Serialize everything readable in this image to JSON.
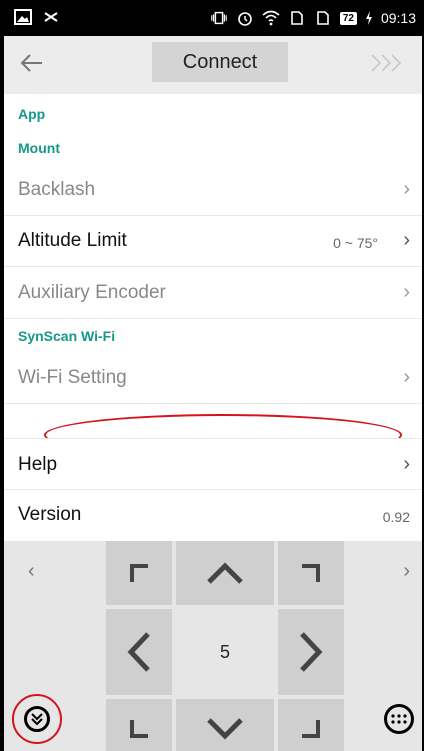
{
  "status_bar": {
    "time": "09:13",
    "battery": "72"
  },
  "toolbar": {
    "connect_label": "Connect"
  },
  "sections": {
    "app": "App",
    "mount": "Mount",
    "wifi": "SynScan Wi-Fi"
  },
  "rows": {
    "backlash": "Backlash",
    "altitude_limit": "Altitude Limit",
    "altitude_value": "0 ~ 75°",
    "auxiliary_encoder": "Auxiliary Encoder",
    "wifi_setting": "Wi-Fi Setting",
    "help": "Help",
    "version": "Version",
    "version_value": "0.92"
  },
  "pad": {
    "rate": "5"
  },
  "colors": {
    "section_text": "#14998a",
    "annotation": "#d4141c"
  }
}
